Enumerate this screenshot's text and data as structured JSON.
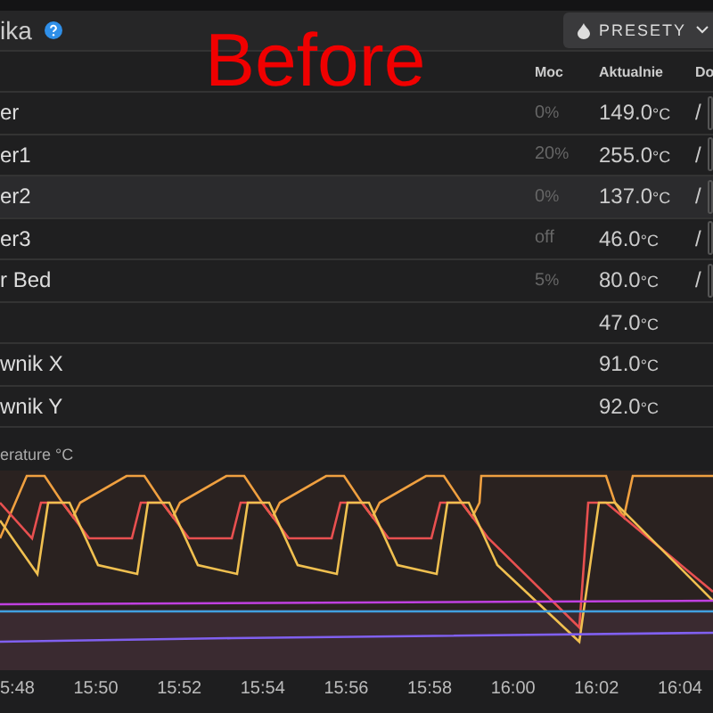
{
  "overlay": {
    "text": "Before"
  },
  "header": {
    "title": "ika",
    "presets_button": "PRESETY"
  },
  "table": {
    "columns": [
      "Moc",
      "Aktualnie",
      "Do"
    ],
    "rows": [
      {
        "name": "er",
        "power": "0",
        "power_unit": "%",
        "current": "149.0",
        "unit": "°C",
        "separator": "/",
        "has_target": true,
        "selected": false
      },
      {
        "name": "er1",
        "power": "20",
        "power_unit": "%",
        "current": "255.0",
        "unit": "°C",
        "separator": "/",
        "has_target": true,
        "selected": false
      },
      {
        "name": "er2",
        "power": "0",
        "power_unit": "%",
        "current": "137.0",
        "unit": "°C",
        "separator": "/",
        "has_target": true,
        "selected": true
      },
      {
        "name": "er3",
        "power": "off",
        "power_unit": "",
        "current": "46.0",
        "unit": "°C",
        "separator": "/",
        "has_target": true,
        "selected": false
      },
      {
        "name": "r Bed",
        "power": "5",
        "power_unit": "%",
        "current": "80.0",
        "unit": "°C",
        "separator": "/",
        "has_target": true,
        "selected": false
      },
      {
        "name": "",
        "power": "",
        "power_unit": "",
        "current": "47.0",
        "unit": "°C",
        "separator": "",
        "has_target": false,
        "selected": false
      },
      {
        "name": "wnik X",
        "power": "",
        "power_unit": "",
        "current": "91.0",
        "unit": "°C",
        "separator": "",
        "has_target": false,
        "selected": false
      },
      {
        "name": "wnik Y",
        "power": "",
        "power_unit": "",
        "current": "92.0",
        "unit": "°C",
        "separator": "",
        "has_target": false,
        "selected": false
      }
    ]
  },
  "chart": {
    "title": "erature °C",
    "xlabels": [
      "5:48",
      "15:50",
      "15:52",
      "15:54",
      "15:56",
      "15:58",
      "16:00",
      "16:02",
      "16:04"
    ]
  }
}
